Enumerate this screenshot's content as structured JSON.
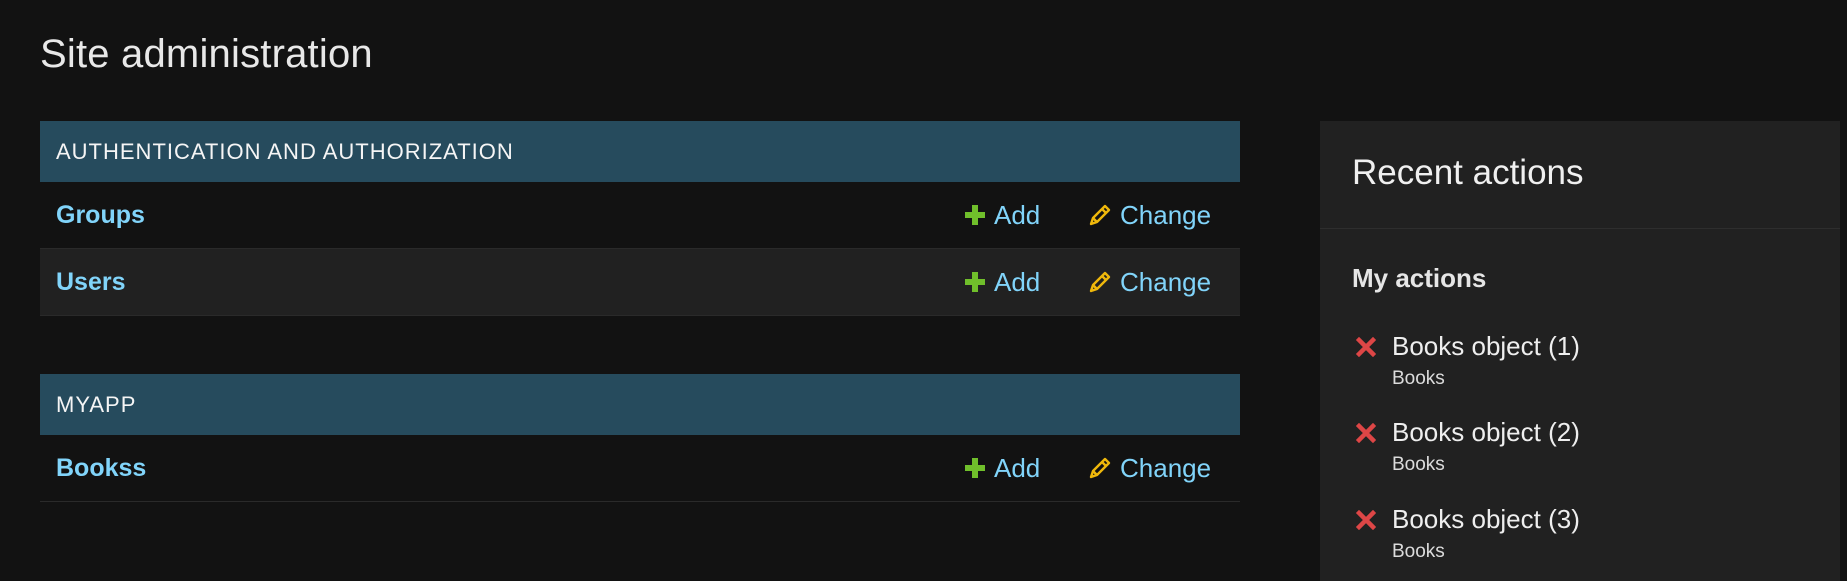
{
  "page_title": "Site administration",
  "modules": [
    {
      "caption": "AUTHENTICATION AND AUTHORIZATION",
      "models": [
        {
          "name": "Groups",
          "add_label": "Add",
          "change_label": "Change"
        },
        {
          "name": "Users",
          "add_label": "Add",
          "change_label": "Change"
        }
      ]
    },
    {
      "caption": "MYAPP",
      "models": [
        {
          "name": "Bookss",
          "add_label": "Add",
          "change_label": "Change"
        }
      ]
    }
  ],
  "recent_actions": {
    "title": "Recent actions",
    "subtitle": "My actions",
    "items": [
      {
        "label": "Books object (1)",
        "type": "Books",
        "icon": "delete-icon"
      },
      {
        "label": "Books object (2)",
        "type": "Books",
        "icon": "delete-icon"
      },
      {
        "label": "Books object (3)",
        "type": "Books",
        "icon": "delete-icon"
      }
    ]
  },
  "colors": {
    "background": "#121212",
    "module_header": "#264b5d",
    "link": "#81d4fa",
    "add_icon": "#70bf2b",
    "change_icon": "#efb80b",
    "delete_icon": "#dd4646"
  }
}
